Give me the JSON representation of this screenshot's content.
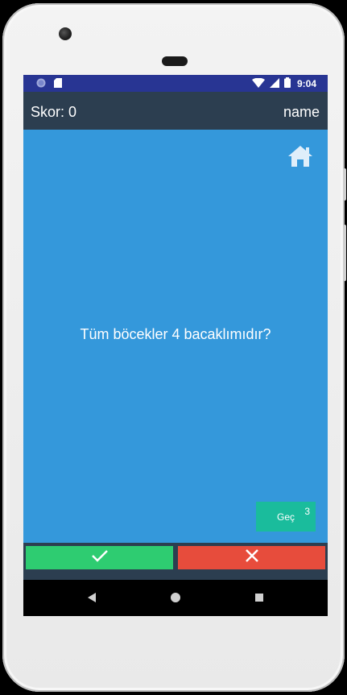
{
  "status_bar": {
    "time": "9:04"
  },
  "app_bar": {
    "score_label": "Skor: 0",
    "player_name": "name"
  },
  "quiz": {
    "question": "Tüm böcekler 4 bacaklımıdır?",
    "skip_label": "Geç",
    "skip_count": "3"
  },
  "colors": {
    "content_bg": "#3498db",
    "app_bar_bg": "#2c3e50",
    "true_button": "#2ecc71",
    "false_button": "#e74c3c",
    "skip_button": "#1abc9c",
    "status_bar_bg": "#283593"
  },
  "icons": {
    "home": "home-icon",
    "true": "check-icon",
    "false": "x-icon",
    "back": "back-triangle-icon",
    "home_nav": "home-circle-icon",
    "recents": "recents-square-icon"
  }
}
